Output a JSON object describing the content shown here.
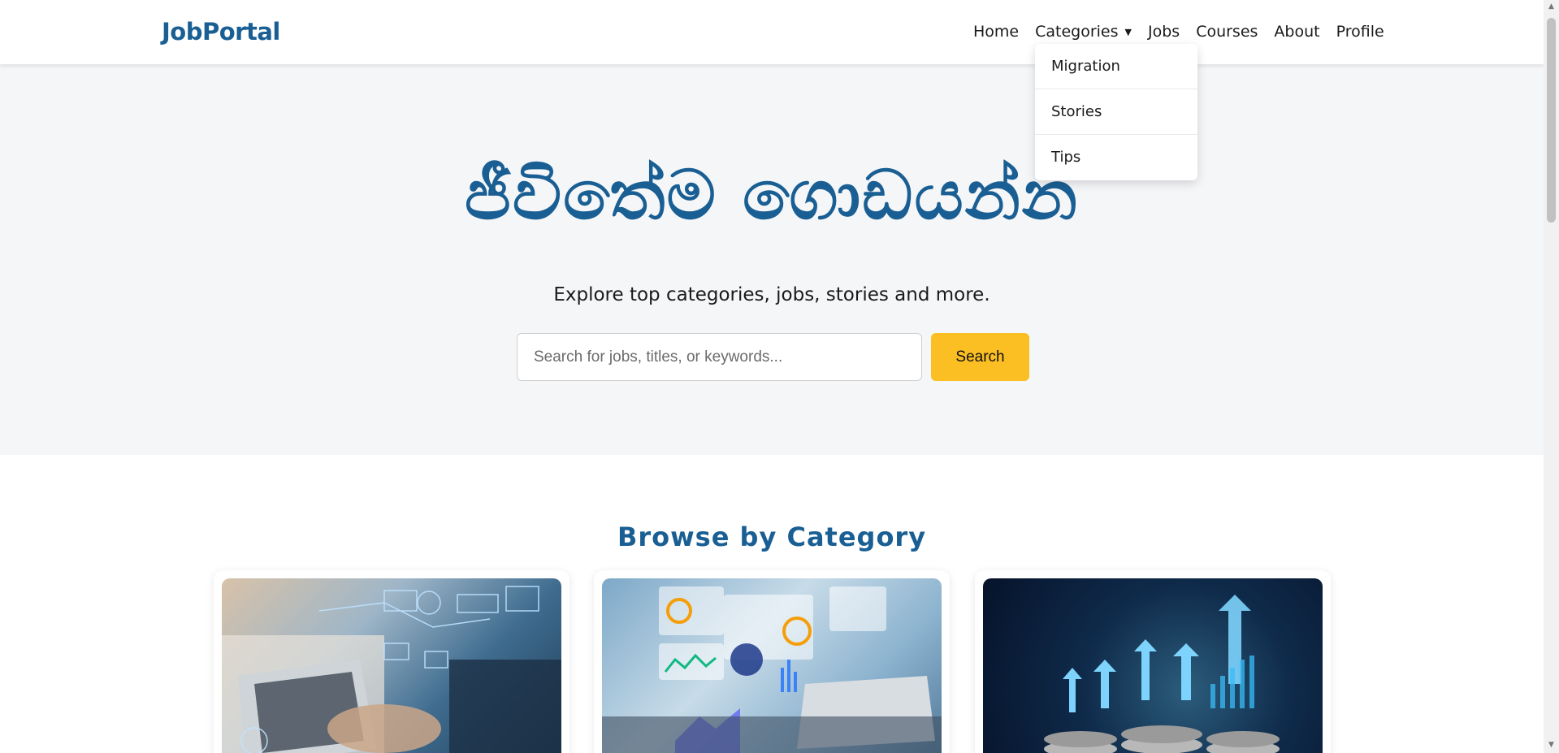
{
  "header": {
    "brand": "JobPortal",
    "nav": {
      "home": "Home",
      "categories": "Categories",
      "jobs": "Jobs",
      "courses": "Courses",
      "about": "About",
      "profile": "Profile"
    },
    "dropdown": [
      "Migration",
      "Stories",
      "Tips"
    ]
  },
  "hero": {
    "title": "ජීවිතේම ගොඩයන්න",
    "subtitle": "Explore top categories, jobs, stories and more.",
    "search_placeholder": "Search for jobs, titles, or keywords...",
    "search_button": "Search"
  },
  "categories": {
    "title": "Browse by Category"
  },
  "colors": {
    "brand": "#1a5f94",
    "accent": "#fbbf24",
    "hero_bg": "#f5f6f8"
  }
}
